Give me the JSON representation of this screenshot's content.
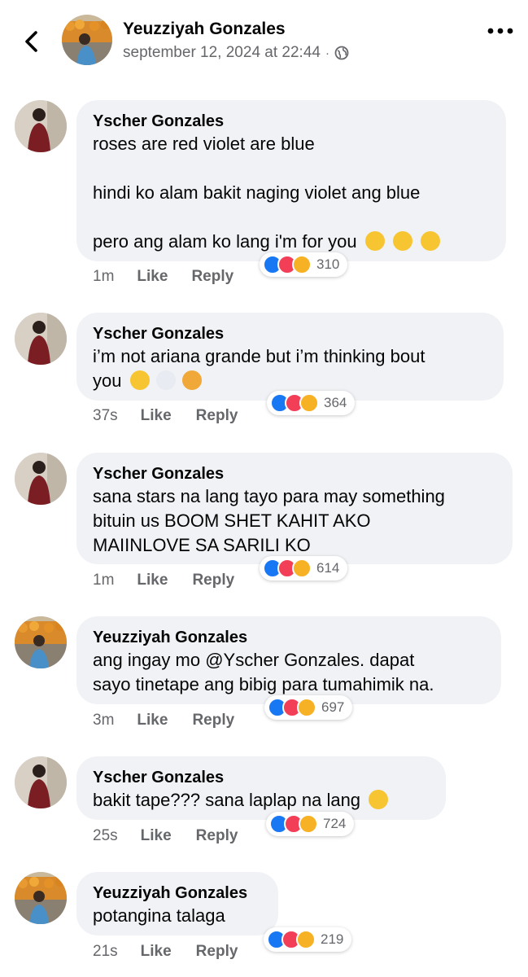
{
  "header": {
    "name": "Yeuzziyah Gonzales",
    "timestamp": "september 12, 2024 at 22:44",
    "separator": "·"
  },
  "comments": [
    {
      "author": "Yscher Gonzales",
      "text": "roses are red violet are blue\n\nhindi ko alam bakit naging violet ang blue\n\npero ang alam ko lang i'm for you",
      "emojis": [
        "heart-eyes-emoji",
        "grin-emoji",
        "kiss-emoji"
      ],
      "time": "1m",
      "like": "Like",
      "reply": "Reply",
      "reaction_count": "310"
    },
    {
      "author": "Yscher Gonzales",
      "text": "i’m not ariana grande but i’m thinking bout\nyou",
      "emojis": [
        "thinking-emoji",
        "thought-bubble-emoji",
        "bowing-emoji"
      ],
      "time": "37s",
      "like": "Like",
      "reply": "Reply",
      "reaction_count": "364"
    },
    {
      "author": "Yscher Gonzales",
      "text": "sana stars na lang tayo para may something\nbituin us BOOM SHET KAHIT AKO\nMAIINLOVE SA SARILI KO",
      "emojis": [],
      "time": "1m",
      "like": "Like",
      "reply": "Reply",
      "reaction_count": "614"
    },
    {
      "author": "Yeuzziyah Gonzales",
      "text": "ang ingay mo @Yscher Gonzales. dapat\nsayo tinetape ang bibig para tumahimik na.",
      "emojis": [],
      "time": "3m",
      "like": "Like",
      "reply": "Reply",
      "reaction_count": "697"
    },
    {
      "author": "Yscher Gonzales",
      "text": "bakit tape??? sana laplap na lang",
      "emojis": [
        "sweat-smile-emoji"
      ],
      "time": "25s",
      "like": "Like",
      "reply": "Reply",
      "reaction_count": "724"
    },
    {
      "author": "Yeuzziyah Gonzales",
      "text": "potangina talaga",
      "emojis": [],
      "time": "21s",
      "like": "Like",
      "reply": "Reply",
      "reaction_count": "219"
    }
  ],
  "colors": {
    "bubble": "#f0f2f5",
    "like": "#1877f2",
    "love": "#f33e58",
    "haha": "#f7b125",
    "muted": "#65676b"
  }
}
